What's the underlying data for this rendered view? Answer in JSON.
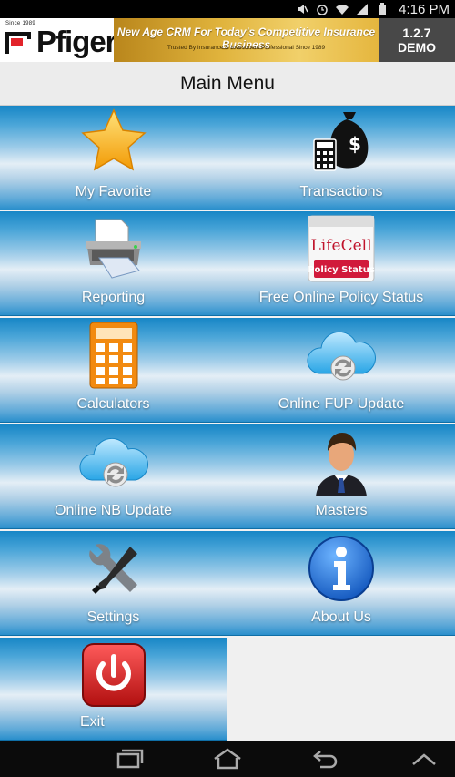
{
  "status_bar": {
    "time": "4:16 PM",
    "icons": [
      "mute-icon",
      "alarm-icon",
      "wifi-icon",
      "signal-icon",
      "battery-icon"
    ]
  },
  "header": {
    "logo_since": "Since 1989",
    "logo_text": "Pfiger",
    "banner_tagline": "New Age CRM For Today's Competitive Insurance Business",
    "banner_subline": "Trusted By Insurance & Investment Professional Since 1989",
    "version": "1.2.7",
    "edition": "DEMO"
  },
  "title": "Main Menu",
  "menu": [
    {
      "label": "My Favorite",
      "icon": "star-icon"
    },
    {
      "label": "Transactions",
      "icon": "money-calculator-icon"
    },
    {
      "label": "Reporting",
      "icon": "printer-icon"
    },
    {
      "label": "Free Online Policy Status",
      "icon": "lifecell-policy-status-icon",
      "icon_text": "LifeCell",
      "icon_badge": "Policy Status"
    },
    {
      "label": "Calculators",
      "icon": "calculator-icon"
    },
    {
      "label": "Online FUP Update",
      "icon": "cloud-sync-icon"
    },
    {
      "label": "Online NB Update",
      "icon": "cloud-sync-icon"
    },
    {
      "label": "Masters",
      "icon": "businessman-icon"
    },
    {
      "label": "Settings",
      "icon": "tools-icon"
    },
    {
      "label": "About Us",
      "icon": "info-icon"
    },
    {
      "label": "Exit",
      "icon": "power-icon"
    }
  ],
  "nav": [
    "recent-apps-icon",
    "home-icon",
    "back-icon",
    "menu-up-icon"
  ],
  "colors": {
    "tile_blue": "#1786c6",
    "version_bg": "#484848",
    "banner_gold": "#e0b33c",
    "exit_red": "#d21e1e",
    "info_blue": "#1e6fd9"
  }
}
